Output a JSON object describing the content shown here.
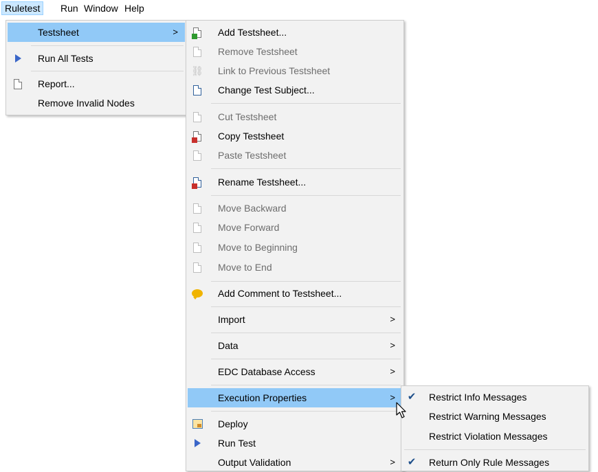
{
  "menubar": {
    "items": [
      {
        "label": "Ruletest",
        "active": true
      },
      {
        "label": "Run"
      },
      {
        "label": "Window"
      },
      {
        "label": "Help"
      }
    ]
  },
  "ruletest_menu": {
    "items": [
      {
        "label": "Testsheet",
        "icon": "none",
        "submenu": true,
        "highlighted": true
      },
      {
        "label": "Run All Tests",
        "icon": "run-triangle-icon"
      },
      {
        "label": "Report...",
        "icon": "report-icon"
      },
      {
        "label": "Remove Invalid Nodes",
        "icon": "none"
      }
    ]
  },
  "testsheet_menu": {
    "items": [
      {
        "label": "Add Testsheet...",
        "icon": "add-testsheet-icon",
        "enabled": true
      },
      {
        "label": "Remove Testsheet",
        "icon": "remove-testsheet-icon",
        "enabled": false
      },
      {
        "label": "Link to Previous Testsheet",
        "icon": "link-icon",
        "enabled": false
      },
      {
        "label": "Change Test Subject...",
        "icon": "change-subject-icon",
        "enabled": true
      },
      {
        "label": "Cut Testsheet",
        "icon": "cut-icon",
        "enabled": false
      },
      {
        "label": "Copy Testsheet",
        "icon": "copy-icon",
        "enabled": true
      },
      {
        "label": "Paste Testsheet",
        "icon": "paste-icon",
        "enabled": false
      },
      {
        "label": "Rename Testsheet...",
        "icon": "rename-icon",
        "enabled": true
      },
      {
        "label": "Move Backward",
        "icon": "move-backward-icon",
        "enabled": false
      },
      {
        "label": "Move Forward",
        "icon": "move-forward-icon",
        "enabled": false
      },
      {
        "label": "Move to Beginning",
        "icon": "move-to-beginning-icon",
        "enabled": false
      },
      {
        "label": "Move to End",
        "icon": "move-to-end-icon",
        "enabled": false
      },
      {
        "label": "Add Comment to Testsheet...",
        "icon": "comment-icon",
        "enabled": true
      },
      {
        "label": "Import",
        "submenu": true,
        "enabled": true
      },
      {
        "label": "Data",
        "submenu": true,
        "enabled": true
      },
      {
        "label": "EDC Database Access",
        "submenu": true,
        "enabled": true
      },
      {
        "label": "Execution Properties",
        "submenu": true,
        "enabled": true,
        "highlighted": true
      },
      {
        "label": "Deploy",
        "icon": "deploy-icon",
        "enabled": true
      },
      {
        "label": "Run Test",
        "icon": "run-triangle-icon",
        "enabled": true
      },
      {
        "label": "Output Validation",
        "submenu": true,
        "enabled": true
      }
    ]
  },
  "execution_properties_menu": {
    "items": [
      {
        "label": "Restrict Info Messages",
        "checked": true
      },
      {
        "label": "Restrict Warning Messages",
        "checked": false
      },
      {
        "label": "Restrict Violation Messages",
        "checked": false
      },
      {
        "label": "Return Only Rule Messages",
        "checked": true
      }
    ]
  },
  "colors": {
    "menu_bg": "#f2f2f2",
    "highlight": "#91c9f7",
    "menubar_active": "#cce8ff",
    "disabled_text": "#6d6d6d"
  }
}
